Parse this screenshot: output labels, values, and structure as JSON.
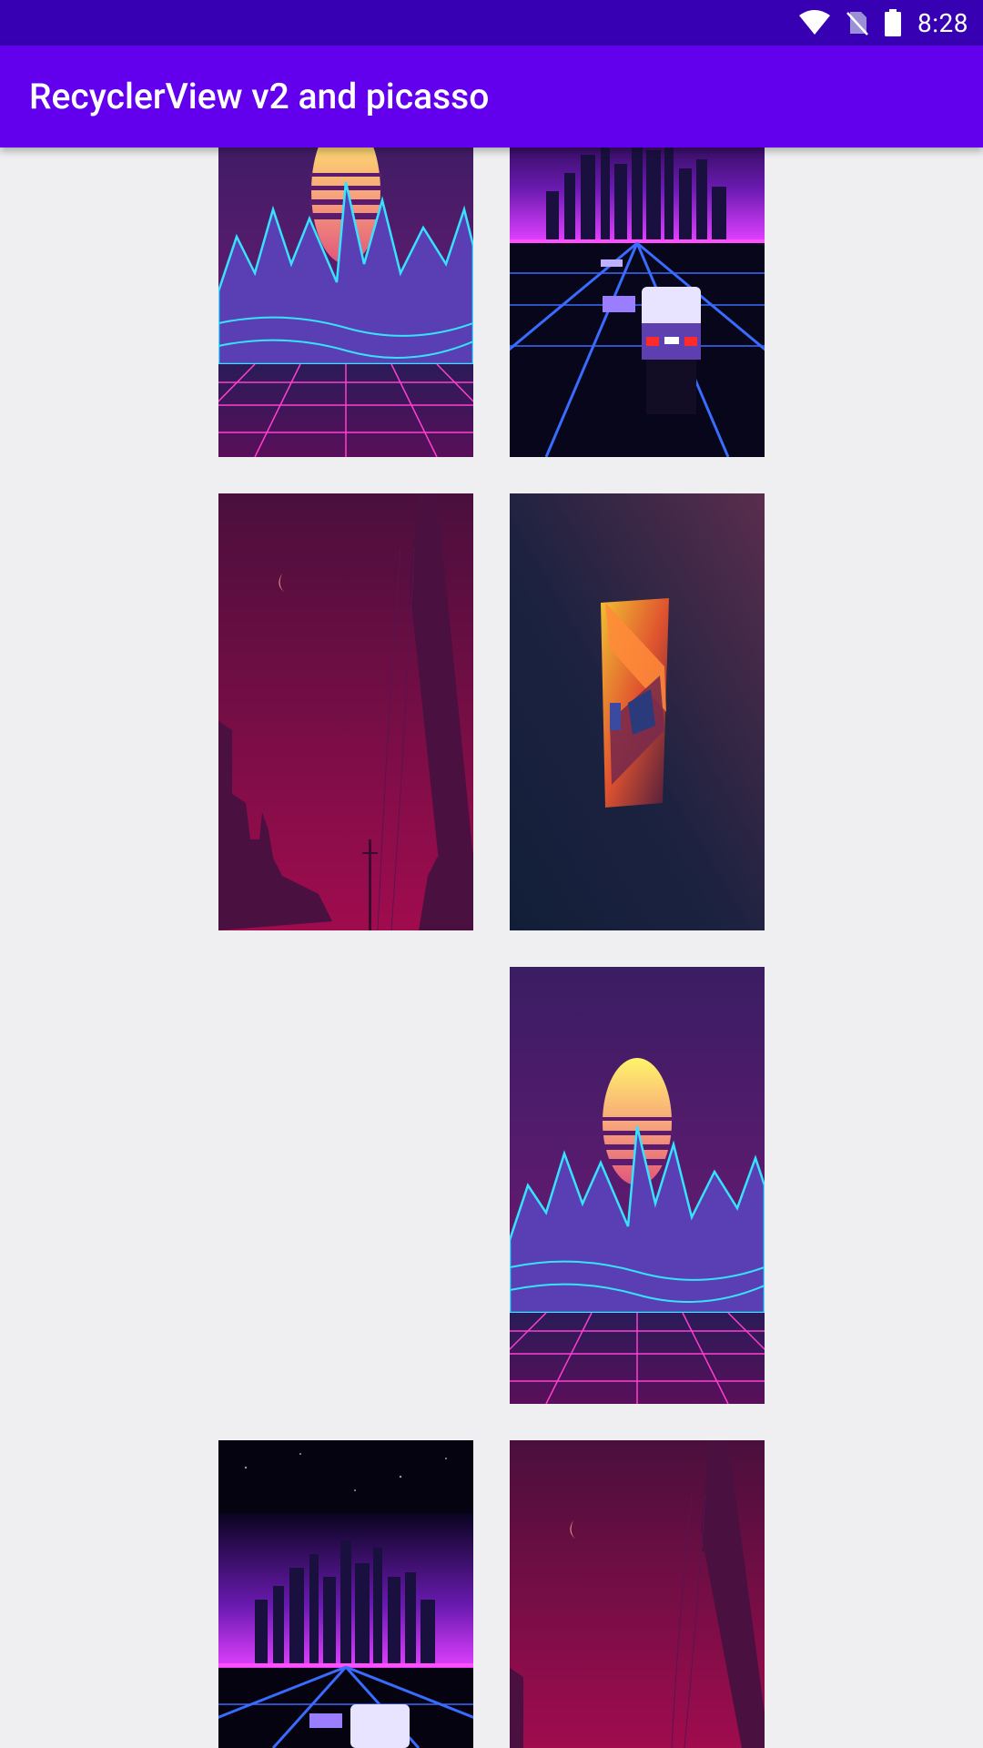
{
  "status_bar": {
    "time": "8:28",
    "icons": [
      "wifi-icon",
      "no-sim-icon",
      "battery-icon"
    ]
  },
  "app_bar": {
    "title": "RecyclerView v2 and picasso",
    "color": "#6200ee"
  },
  "colors": {
    "status_bar": "#3700b3",
    "background": "#efeef0"
  },
  "grid": {
    "tiles": [
      {
        "image": "synthwave-sun-mountains"
      },
      {
        "image": "synthwave-city-highway-car"
      },
      {
        "image": "purple-moon-powerline"
      },
      {
        "image": "abstract-geometric-shape"
      },
      {
        "image": "empty"
      },
      {
        "image": "synthwave-sun-mountains"
      },
      {
        "image": "synthwave-city-highway-car"
      },
      {
        "image": "purple-moon-powerline"
      }
    ]
  }
}
